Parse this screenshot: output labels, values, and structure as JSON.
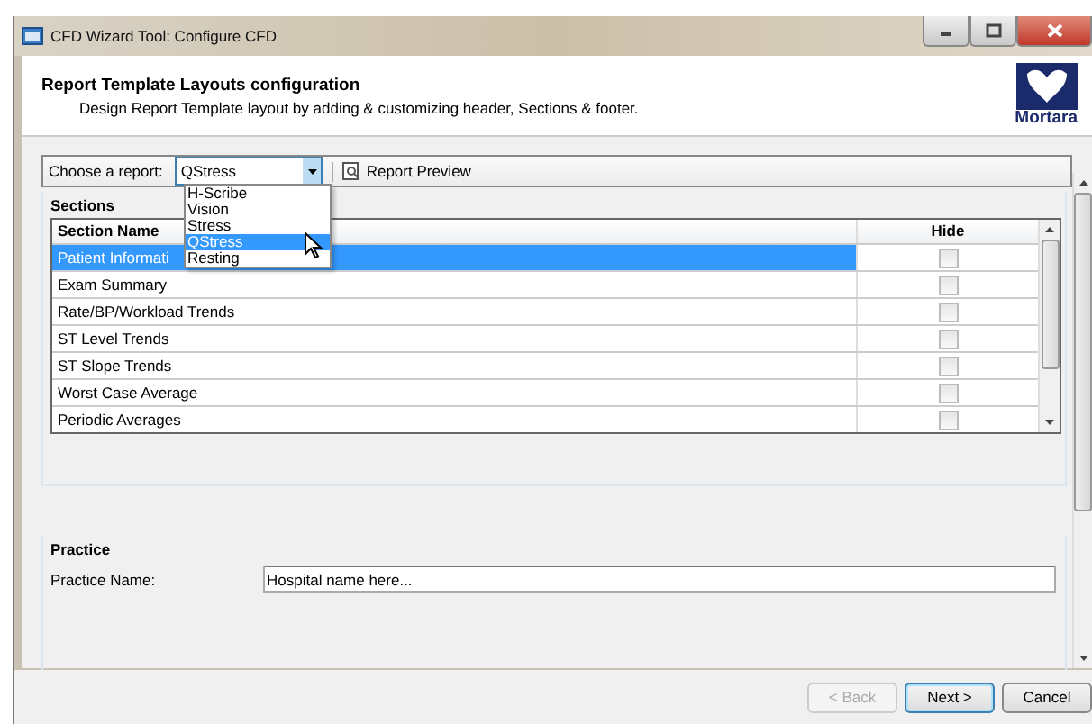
{
  "window": {
    "title": "CFD Wizard Tool: Configure CFD"
  },
  "header": {
    "title": "Report Template Layouts configuration",
    "subtitle": "Design Report Template layout by adding & customizing header, Sections & footer.",
    "logo_text": "Mortara"
  },
  "toolbar": {
    "report_label": "Choose a report:",
    "report_value": "QStress",
    "preview_button": "Report Preview"
  },
  "dropdown": {
    "options": [
      {
        "label": "H-Scribe",
        "selected": false
      },
      {
        "label": "Vision",
        "selected": false
      },
      {
        "label": "Stress",
        "selected": false
      },
      {
        "label": "QStress",
        "selected": true
      },
      {
        "label": "Resting",
        "selected": false
      }
    ]
  },
  "sections": {
    "title": "Sections",
    "columns": [
      "Section Name",
      "Hide"
    ],
    "rows": [
      {
        "name": "Patient Informati",
        "hide": false,
        "selected": true
      },
      {
        "name": "Exam Summary",
        "hide": false,
        "selected": false
      },
      {
        "name": "Rate/BP/Workload Trends",
        "hide": false,
        "selected": false
      },
      {
        "name": "ST Level Trends",
        "hide": false,
        "selected": false
      },
      {
        "name": "ST Slope Trends",
        "hide": false,
        "selected": false
      },
      {
        "name": "Worst Case Average",
        "hide": false,
        "selected": false
      },
      {
        "name": "Periodic Averages",
        "hide": false,
        "selected": false
      }
    ]
  },
  "practice": {
    "title": "Practice",
    "label": "Practice Name:",
    "value": "Hospital name here..."
  },
  "buttons": [
    {
      "label": "< Back",
      "disabled": true,
      "default": false
    },
    {
      "label": "Next >",
      "disabled": false,
      "default": true
    },
    {
      "label": "Cancel",
      "disabled": false,
      "default": false
    }
  ]
}
